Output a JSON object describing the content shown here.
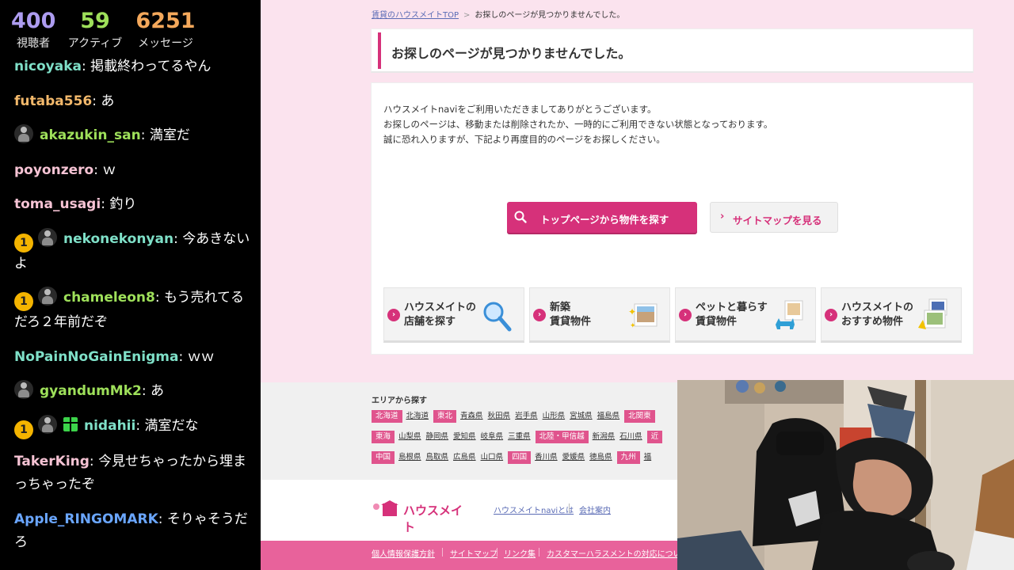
{
  "stats": {
    "viewers": "400",
    "viewers_label": "視聴者",
    "active": "59",
    "active_label": "アクティブ",
    "messages": "6251",
    "messages_label": "メッセージ"
  },
  "chat": [
    {
      "user": "nicoyaka",
      "text": "掲載終わってるやん",
      "color": "#7fe0c8"
    },
    {
      "user": "futaba556",
      "text": "あ",
      "color": "#f2b86b"
    },
    {
      "user": "akazukin_san",
      "text": "満室だ",
      "color": "#9ee05a"
    },
    {
      "user": "poyonzero",
      "text": "ｗ",
      "color": "#f6c3d4"
    },
    {
      "user": "toma_usagi",
      "text": "釣り",
      "color": "#f6c3d4"
    },
    {
      "badge": "1",
      "user": "nekonekonyan",
      "text": "今あきないよ",
      "color": "#7fe0c8"
    },
    {
      "badge": "1",
      "user": "chameleon8",
      "text": "もう売れてるだろ２年前だぞ",
      "color": "#9ee05a"
    },
    {
      "user": "NoPainNoGainEnigma",
      "text": "ｗｗ",
      "color": "#7fe0c8"
    },
    {
      "user": "gyandumMk2",
      "text": "あ",
      "color": "#9ee05a"
    },
    {
      "badge": "1",
      "user": "nidahii",
      "text": "満室だな",
      "color": "#7fe0c8"
    },
    {
      "user": "TakerKing",
      "text": "今見せちゃったから埋まっちゃったぞ",
      "color": "#f6c3d4"
    },
    {
      "user": "Apple_RINGOMARK",
      "text": "そりゃそうだろ",
      "color": "#6aa6ff"
    }
  ],
  "page": {
    "breadcrumb_home": "賃貸のハウスメイトTOP",
    "breadcrumb_current": "お探しのページが見つかりませんでした。",
    "heading": "お探しのページが見つかりませんでした。",
    "body_lines": [
      "ハウスメイトnaviをご利用いただきましてありがとうございます。",
      "お探しのページは、移動または削除されたか、一時的にご利用できない状態となっております。",
      "誠に恐れ入りますが、下記より再度目的のページをお探しください。"
    ],
    "btn_top": "トップページから物件を探す",
    "btn_sitemap": "サイトマップを見る",
    "cards": [
      {
        "line1": "ハウスメイトの",
        "line2": "店舗を探す"
      },
      {
        "line1": "新築",
        "line2": "賃貸物件"
      },
      {
        "line1": "ペットと暮らす",
        "line2": "賃貸物件"
      },
      {
        "line1": "ハウスメイトの",
        "line2": "おすすめ物件"
      }
    ],
    "area_title": "エリアから探す",
    "area_rows": [
      [
        {
          "reg": "北海道"
        },
        {
          "p": "北海道"
        },
        {
          "reg": "東北"
        },
        {
          "p": "青森県"
        },
        {
          "p": "秋田県"
        },
        {
          "p": "岩手県"
        },
        {
          "p": "山形県"
        },
        {
          "p": "宮城県"
        },
        {
          "p": "福島県"
        },
        {
          "reg": "北関東"
        }
      ],
      [
        {
          "reg": "東海"
        },
        {
          "p": "山梨県"
        },
        {
          "p": "静岡県"
        },
        {
          "p": "愛知県"
        },
        {
          "p": "岐阜県"
        },
        {
          "p": "三重県"
        },
        {
          "reg": "北陸・甲信越"
        },
        {
          "p": "新潟県"
        },
        {
          "p": "石川県"
        },
        {
          "reg": "近"
        }
      ],
      [
        {
          "reg": "中国"
        },
        {
          "p": "島根県"
        },
        {
          "p": "鳥取県"
        },
        {
          "p": "広島県"
        },
        {
          "p": "山口県"
        },
        {
          "reg": "四国"
        },
        {
          "p": "香川県"
        },
        {
          "p": "愛媛県"
        },
        {
          "p": "徳島県"
        },
        {
          "reg": "九州"
        },
        {
          "p": "福"
        }
      ]
    ],
    "logo_name": "ハウスメイト",
    "footer_link_about": "ハウスメイトnaviとは",
    "footer_link_company": "会社案内",
    "bottom_links": [
      "個人情報保護方針",
      "サイトマップ",
      "リンク集",
      "カスタマーハラスメントの対応について"
    ],
    "accent_color": "#d6317a"
  }
}
